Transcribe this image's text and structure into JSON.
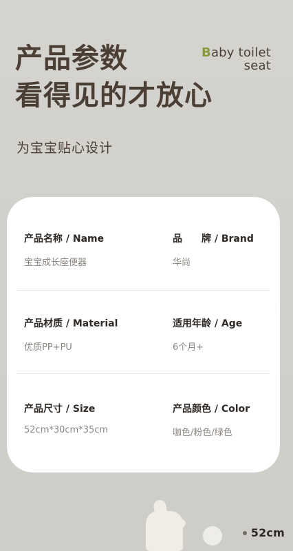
{
  "header": {
    "title_line_1": "产品参数",
    "title_line_2": "看得见的才放心",
    "subtitle": "为宝宝贴心设计",
    "brand_mark": {
      "accent": "B",
      "line_1_rest": "aby toilet",
      "line_2": "seat"
    }
  },
  "specs": [
    {
      "label": "产品名称 / Name",
      "value": "宝宝成长座便器"
    },
    {
      "label": "品　　牌 / Brand",
      "value": "华尚"
    },
    {
      "label": "产品材质 / Material",
      "value": "优质PP+PU"
    },
    {
      "label": "适用年龄 / Age",
      "value": "6个月+"
    },
    {
      "label": "产品尺寸 / Size",
      "value": "52cm*30cm*35cm"
    },
    {
      "label": "产品颜色 / Color",
      "value": "咖色/粉色/绿色"
    }
  ],
  "bottom": {
    "dimension_label": "52cm"
  }
}
